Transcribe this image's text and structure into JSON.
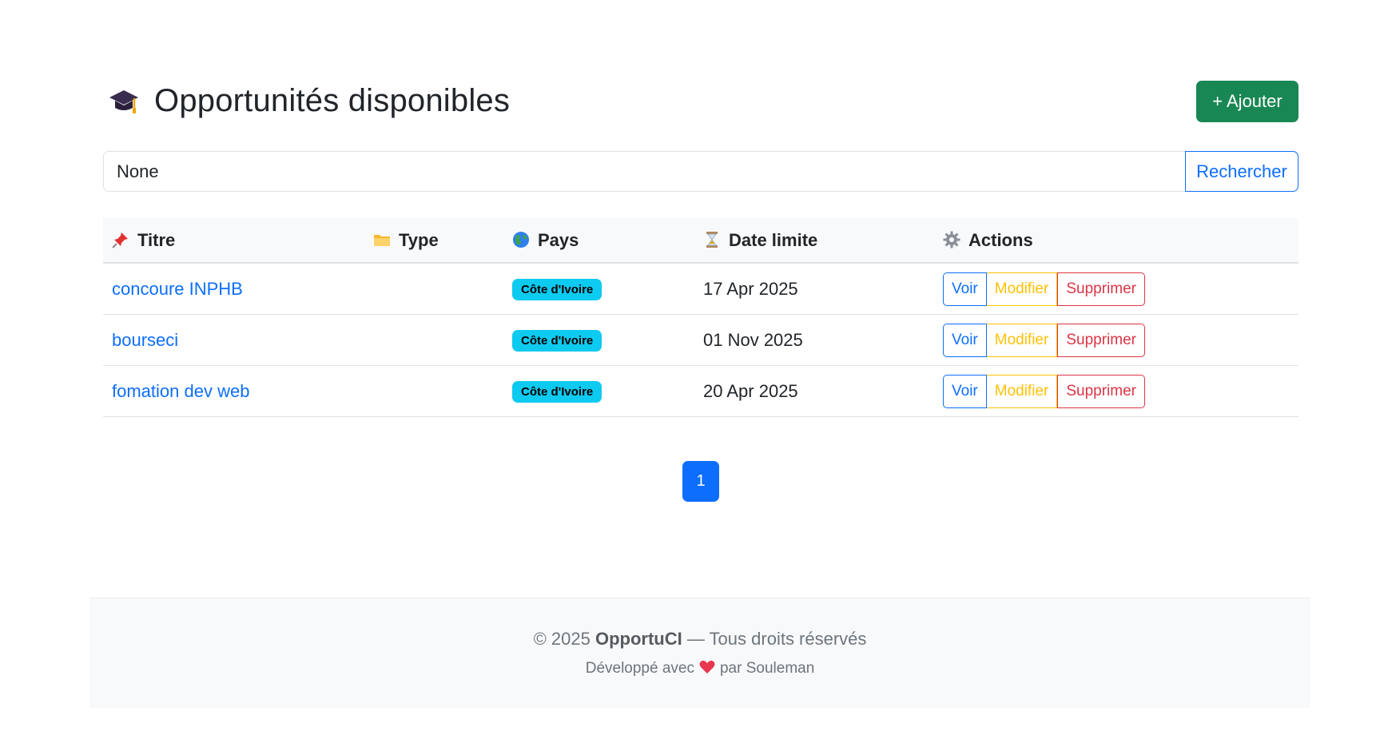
{
  "header": {
    "title": "Opportunités disponibles",
    "add_label": "+ Ajouter",
    "icon": "graduation-cap-icon"
  },
  "search": {
    "value": "None",
    "button_label": "Rechercher"
  },
  "table": {
    "columns": [
      {
        "label": "Titre",
        "icon": "pushpin-icon"
      },
      {
        "label": "Type",
        "icon": "folder-icon"
      },
      {
        "label": "Pays",
        "icon": "globe-icon"
      },
      {
        "label": "Date limite",
        "icon": "hourglass-icon"
      },
      {
        "label": "Actions",
        "icon": "gear-icon"
      }
    ],
    "rows": [
      {
        "title": "concoure INPHB",
        "type": "",
        "country": "Côte d'Ivoire",
        "deadline": "17 Apr 2025"
      },
      {
        "title": "bourseci",
        "type": "",
        "country": "Côte d'Ivoire",
        "deadline": "01 Nov 2025"
      },
      {
        "title": "fomation dev web",
        "type": "",
        "country": "Côte d'Ivoire",
        "deadline": "20 Apr 2025"
      }
    ],
    "actions": {
      "view": "Voir",
      "edit": "Modifier",
      "delete": "Supprimer"
    }
  },
  "pagination": {
    "current": "1"
  },
  "footer": {
    "copyright_prefix": "© 2025 ",
    "brand": "OpportuCI",
    "copyright_suffix": " — Tous droits réservés",
    "dev_prefix": "Développé avec",
    "dev_suffix": "par Souleman",
    "heart_icon": "heart-icon"
  },
  "colors": {
    "primary": "#0d6efd",
    "success": "#198754",
    "warning": "#ffc107",
    "danger": "#dc3545",
    "info": "#0dcaf0"
  }
}
